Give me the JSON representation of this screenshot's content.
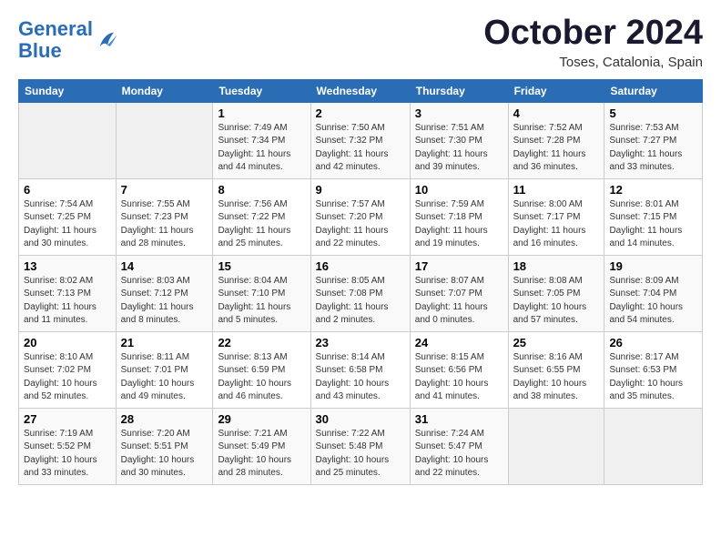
{
  "header": {
    "logo_line1": "General",
    "logo_line2": "Blue",
    "month": "October 2024",
    "location": "Toses, Catalonia, Spain"
  },
  "weekdays": [
    "Sunday",
    "Monday",
    "Tuesday",
    "Wednesday",
    "Thursday",
    "Friday",
    "Saturday"
  ],
  "weeks": [
    [
      {
        "day": "",
        "info": ""
      },
      {
        "day": "",
        "info": ""
      },
      {
        "day": "1",
        "info": "Sunrise: 7:49 AM\nSunset: 7:34 PM\nDaylight: 11 hours and 44 minutes."
      },
      {
        "day": "2",
        "info": "Sunrise: 7:50 AM\nSunset: 7:32 PM\nDaylight: 11 hours and 42 minutes."
      },
      {
        "day": "3",
        "info": "Sunrise: 7:51 AM\nSunset: 7:30 PM\nDaylight: 11 hours and 39 minutes."
      },
      {
        "day": "4",
        "info": "Sunrise: 7:52 AM\nSunset: 7:28 PM\nDaylight: 11 hours and 36 minutes."
      },
      {
        "day": "5",
        "info": "Sunrise: 7:53 AM\nSunset: 7:27 PM\nDaylight: 11 hours and 33 minutes."
      }
    ],
    [
      {
        "day": "6",
        "info": "Sunrise: 7:54 AM\nSunset: 7:25 PM\nDaylight: 11 hours and 30 minutes."
      },
      {
        "day": "7",
        "info": "Sunrise: 7:55 AM\nSunset: 7:23 PM\nDaylight: 11 hours and 28 minutes."
      },
      {
        "day": "8",
        "info": "Sunrise: 7:56 AM\nSunset: 7:22 PM\nDaylight: 11 hours and 25 minutes."
      },
      {
        "day": "9",
        "info": "Sunrise: 7:57 AM\nSunset: 7:20 PM\nDaylight: 11 hours and 22 minutes."
      },
      {
        "day": "10",
        "info": "Sunrise: 7:59 AM\nSunset: 7:18 PM\nDaylight: 11 hours and 19 minutes."
      },
      {
        "day": "11",
        "info": "Sunrise: 8:00 AM\nSunset: 7:17 PM\nDaylight: 11 hours and 16 minutes."
      },
      {
        "day": "12",
        "info": "Sunrise: 8:01 AM\nSunset: 7:15 PM\nDaylight: 11 hours and 14 minutes."
      }
    ],
    [
      {
        "day": "13",
        "info": "Sunrise: 8:02 AM\nSunset: 7:13 PM\nDaylight: 11 hours and 11 minutes."
      },
      {
        "day": "14",
        "info": "Sunrise: 8:03 AM\nSunset: 7:12 PM\nDaylight: 11 hours and 8 minutes."
      },
      {
        "day": "15",
        "info": "Sunrise: 8:04 AM\nSunset: 7:10 PM\nDaylight: 11 hours and 5 minutes."
      },
      {
        "day": "16",
        "info": "Sunrise: 8:05 AM\nSunset: 7:08 PM\nDaylight: 11 hours and 2 minutes."
      },
      {
        "day": "17",
        "info": "Sunrise: 8:07 AM\nSunset: 7:07 PM\nDaylight: 11 hours and 0 minutes."
      },
      {
        "day": "18",
        "info": "Sunrise: 8:08 AM\nSunset: 7:05 PM\nDaylight: 10 hours and 57 minutes."
      },
      {
        "day": "19",
        "info": "Sunrise: 8:09 AM\nSunset: 7:04 PM\nDaylight: 10 hours and 54 minutes."
      }
    ],
    [
      {
        "day": "20",
        "info": "Sunrise: 8:10 AM\nSunset: 7:02 PM\nDaylight: 10 hours and 52 minutes."
      },
      {
        "day": "21",
        "info": "Sunrise: 8:11 AM\nSunset: 7:01 PM\nDaylight: 10 hours and 49 minutes."
      },
      {
        "day": "22",
        "info": "Sunrise: 8:13 AM\nSunset: 6:59 PM\nDaylight: 10 hours and 46 minutes."
      },
      {
        "day": "23",
        "info": "Sunrise: 8:14 AM\nSunset: 6:58 PM\nDaylight: 10 hours and 43 minutes."
      },
      {
        "day": "24",
        "info": "Sunrise: 8:15 AM\nSunset: 6:56 PM\nDaylight: 10 hours and 41 minutes."
      },
      {
        "day": "25",
        "info": "Sunrise: 8:16 AM\nSunset: 6:55 PM\nDaylight: 10 hours and 38 minutes."
      },
      {
        "day": "26",
        "info": "Sunrise: 8:17 AM\nSunset: 6:53 PM\nDaylight: 10 hours and 35 minutes."
      }
    ],
    [
      {
        "day": "27",
        "info": "Sunrise: 7:19 AM\nSunset: 5:52 PM\nDaylight: 10 hours and 33 minutes."
      },
      {
        "day": "28",
        "info": "Sunrise: 7:20 AM\nSunset: 5:51 PM\nDaylight: 10 hours and 30 minutes."
      },
      {
        "day": "29",
        "info": "Sunrise: 7:21 AM\nSunset: 5:49 PM\nDaylight: 10 hours and 28 minutes."
      },
      {
        "day": "30",
        "info": "Sunrise: 7:22 AM\nSunset: 5:48 PM\nDaylight: 10 hours and 25 minutes."
      },
      {
        "day": "31",
        "info": "Sunrise: 7:24 AM\nSunset: 5:47 PM\nDaylight: 10 hours and 22 minutes."
      },
      {
        "day": "",
        "info": ""
      },
      {
        "day": "",
        "info": ""
      }
    ]
  ]
}
